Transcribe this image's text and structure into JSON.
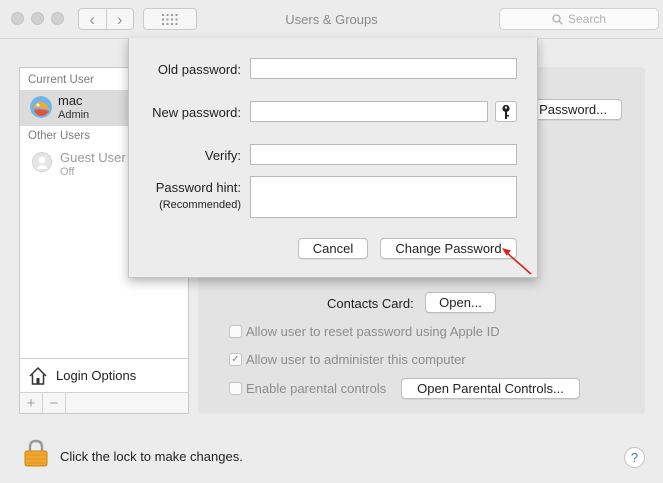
{
  "window": {
    "title": "Users & Groups"
  },
  "toolbar": {
    "back_icon": "‹",
    "forward_icon": "›",
    "search_placeholder": "Search"
  },
  "sidebar": {
    "current_header": "Current User",
    "other_header": "Other Users",
    "users": [
      {
        "name": "mac",
        "role": "Admin"
      },
      {
        "name": "Guest User",
        "role": "Off"
      }
    ],
    "login_options": "Login Options",
    "add_icon": "+",
    "remove_icon": "−"
  },
  "main": {
    "change_password_partial": "Password...",
    "contacts_card_label": "Contacts Card:",
    "open_button": "Open...",
    "reset_with_apple_id": "Allow user to reset password using Apple ID",
    "administer": "Allow user to administer this computer",
    "administer_checked": true,
    "parental_controls": "Enable parental controls",
    "open_parental_controls": "Open Parental Controls..."
  },
  "sheet": {
    "old_password_label": "Old password:",
    "new_password_label": "New password:",
    "verify_label": "Verify:",
    "hint_label": "Password hint:",
    "hint_sub": "(Recommended)",
    "old_password_value": "",
    "new_password_value": "",
    "verify_value": "",
    "hint_value": "",
    "cancel": "Cancel",
    "change_password": "Change Password"
  },
  "footer": {
    "lock_text": "Click the lock to make changes.",
    "help": "?"
  },
  "colors": {
    "accent_arrow": "#e0201b",
    "help_blue": "#3f7ad6",
    "lock_orange": "#f0a52c"
  }
}
